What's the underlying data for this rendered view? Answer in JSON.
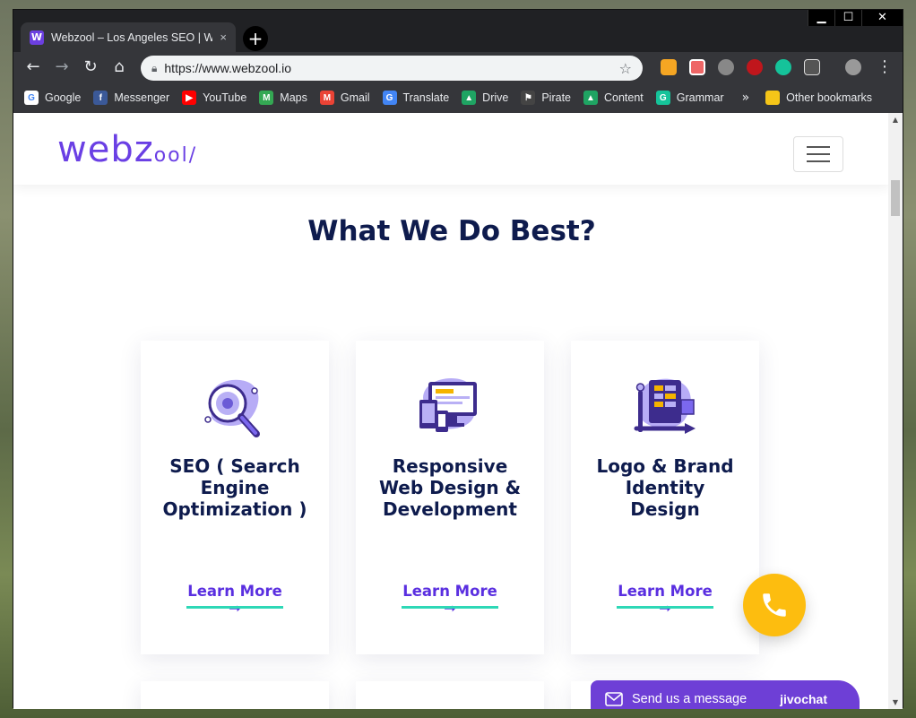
{
  "browser": {
    "tab_title": "Webzool – Los Angeles SEO | We",
    "tab_favicon": "W",
    "tab_close": "×",
    "new_tab": "+",
    "window_controls": {
      "minimize": "▁",
      "maximize": "☐",
      "close": "✕"
    },
    "nav": {
      "back": "←",
      "forward": "→",
      "reload": "↻",
      "home": "⌂"
    },
    "url": "https://www.webzool.io",
    "bookmark_star": "☆",
    "menu": "⋮"
  },
  "bookmarks": {
    "items": [
      {
        "label": "Google",
        "icon": "G",
        "color": "#ffffff",
        "text_color": "#4285f4"
      },
      {
        "label": "Messenger",
        "icon": "f",
        "color": "#3b5998"
      },
      {
        "label": "YouTube",
        "icon": "▶",
        "color": "#ff0000"
      },
      {
        "label": "Maps",
        "icon": "M",
        "color": "#34a853"
      },
      {
        "label": "Gmail",
        "icon": "M",
        "color": "#ea4335"
      },
      {
        "label": "Translate",
        "icon": "G",
        "color": "#4285f4"
      },
      {
        "label": "Drive",
        "icon": "▲",
        "color": "#1fa463"
      },
      {
        "label": "Pirate",
        "icon": "⚑",
        "color": "#444444"
      },
      {
        "label": "Content",
        "icon": "▲",
        "color": "#1fa463"
      },
      {
        "label": "Grammar",
        "icon": "G",
        "color": "#15c39a"
      }
    ],
    "more": "»",
    "other": "Other bookmarks"
  },
  "site": {
    "logo_main": "webz",
    "logo_suffix": "ool",
    "section_title": "What We Do Best?",
    "cards": [
      {
        "title": "SEO ( Search Engine Optimization )",
        "link": "Learn More ➞",
        "icon": "magnifier-seo-icon"
      },
      {
        "title": "Responsive Web Design & Development",
        "link": "Learn More ➞",
        "icon": "devices-icon"
      },
      {
        "title": "Logo & Brand Identity Design",
        "link": "Learn More ➞",
        "icon": "palette-design-icon"
      }
    ],
    "chat": {
      "label": "Send us a message",
      "brand": "jivochat"
    }
  },
  "colors": {
    "accent": "#5a2fe0",
    "underline": "#2ed8b6",
    "heading": "#0e1b4d",
    "call": "#fdbd0f",
    "chat": "#6e3fd6"
  }
}
